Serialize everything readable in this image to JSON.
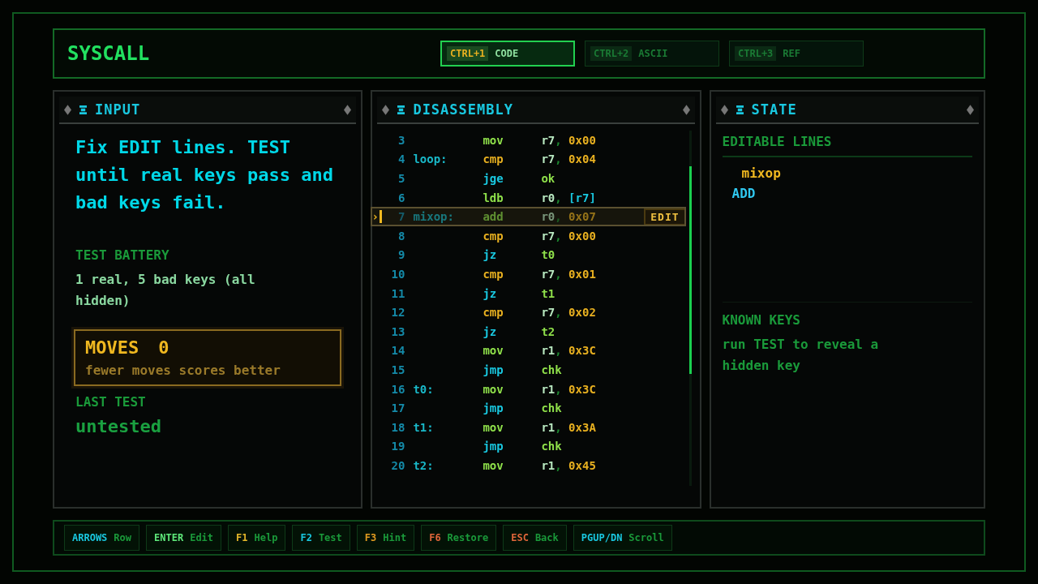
{
  "app_title": "SYSCALL",
  "tabs": [
    {
      "key": "CTRL+1",
      "label": "CODE",
      "selected": true
    },
    {
      "key": "CTRL+2",
      "label": "ASCII",
      "selected": false
    },
    {
      "key": "CTRL+3",
      "label": "REF",
      "selected": false
    }
  ],
  "input_panel": {
    "title": "INPUT",
    "instructions": "Fix EDIT lines. TEST until real keys pass and bad keys fail.",
    "battery_label": "TEST BATTERY",
    "battery_text": "1 real, 5 bad keys (all hidden)",
    "moves": {
      "label": "MOVES",
      "value": "0",
      "hint": "fewer moves scores better"
    },
    "last_test_label": "LAST TEST",
    "last_test_value": "untested"
  },
  "disassembly": {
    "title": "DISASSEMBLY",
    "edit_badge": "EDIT",
    "cursor": "›",
    "lines": [
      {
        "num": "3",
        "op": "mov",
        "kind": "move",
        "args": [
          {
            "text": "r7",
            "kind": "reg"
          },
          {
            "text": ",",
            "kind": "punct"
          },
          {
            "text": " 0x00",
            "kind": "imm"
          }
        ],
        "selected": false
      },
      {
        "num": "4",
        "label": "loop:",
        "op": "cmp",
        "kind": "compare",
        "args": [
          {
            "text": "r7",
            "kind": "reg"
          },
          {
            "text": ",",
            "kind": "punct"
          },
          {
            "text": " 0x04",
            "kind": "imm"
          }
        ],
        "selected": false
      },
      {
        "num": "5",
        "op": "jge",
        "kind": "jump",
        "args": [
          {
            "text": "ok",
            "kind": "target"
          }
        ],
        "selected": false
      },
      {
        "num": "6",
        "op": "ldb",
        "kind": "move",
        "args": [
          {
            "text": "r0",
            "kind": "reg"
          },
          {
            "text": ",",
            "kind": "punct"
          },
          {
            "text": " [r7]",
            "kind": "mem"
          }
        ],
        "selected": false
      },
      {
        "num": "7",
        "label": "mixop:",
        "op": "add",
        "kind": "move",
        "args": [
          {
            "text": "r0",
            "kind": "reg"
          },
          {
            "text": ",",
            "kind": "punct"
          },
          {
            "text": " 0x07",
            "kind": "imm"
          }
        ],
        "selected": true
      },
      {
        "num": "8",
        "op": "cmp",
        "kind": "compare",
        "args": [
          {
            "text": "r7",
            "kind": "reg"
          },
          {
            "text": ",",
            "kind": "punct"
          },
          {
            "text": " 0x00",
            "kind": "imm"
          }
        ],
        "selected": false
      },
      {
        "num": "9",
        "op": "jz",
        "kind": "jump",
        "args": [
          {
            "text": "t0",
            "kind": "target"
          }
        ],
        "selected": false
      },
      {
        "num": "10",
        "op": "cmp",
        "kind": "compare",
        "args": [
          {
            "text": "r7",
            "kind": "reg"
          },
          {
            "text": ",",
            "kind": "punct"
          },
          {
            "text": " 0x01",
            "kind": "imm"
          }
        ],
        "selected": false
      },
      {
        "num": "11",
        "op": "jz",
        "kind": "jump",
        "args": [
          {
            "text": "t1",
            "kind": "target"
          }
        ],
        "selected": false
      },
      {
        "num": "12",
        "op": "cmp",
        "kind": "compare",
        "args": [
          {
            "text": "r7",
            "kind": "reg"
          },
          {
            "text": ",",
            "kind": "punct"
          },
          {
            "text": " 0x02",
            "kind": "imm"
          }
        ],
        "selected": false
      },
      {
        "num": "13",
        "op": "jz",
        "kind": "jump",
        "args": [
          {
            "text": "t2",
            "kind": "target"
          }
        ],
        "selected": false
      },
      {
        "num": "14",
        "op": "mov",
        "kind": "move",
        "args": [
          {
            "text": "r1",
            "kind": "reg"
          },
          {
            "text": ",",
            "kind": "punct"
          },
          {
            "text": " 0x3C",
            "kind": "imm"
          }
        ],
        "selected": false
      },
      {
        "num": "15",
        "op": "jmp",
        "kind": "jump",
        "args": [
          {
            "text": "chk",
            "kind": "target"
          }
        ],
        "selected": false
      },
      {
        "num": "16",
        "label": "t0:",
        "op": "mov",
        "kind": "move",
        "args": [
          {
            "text": "r1",
            "kind": "reg"
          },
          {
            "text": ",",
            "kind": "punct"
          },
          {
            "text": " 0x3C",
            "kind": "imm"
          }
        ],
        "selected": false
      },
      {
        "num": "17",
        "op": "jmp",
        "kind": "jump",
        "args": [
          {
            "text": "chk",
            "kind": "target"
          }
        ],
        "selected": false
      },
      {
        "num": "18",
        "label": "t1:",
        "op": "mov",
        "kind": "move",
        "args": [
          {
            "text": "r1",
            "kind": "reg"
          },
          {
            "text": ",",
            "kind": "punct"
          },
          {
            "text": " 0x3A",
            "kind": "imm"
          }
        ],
        "selected": false
      },
      {
        "num": "19",
        "op": "jmp",
        "kind": "jump",
        "args": [
          {
            "text": "chk",
            "kind": "target"
          }
        ],
        "selected": false
      },
      {
        "num": "20",
        "label": "t2:",
        "op": "mov",
        "kind": "move",
        "args": [
          {
            "text": "r1",
            "kind": "reg"
          },
          {
            "text": ",",
            "kind": "punct"
          },
          {
            "text": " 0x45",
            "kind": "imm"
          }
        ],
        "selected": false
      }
    ]
  },
  "state_panel": {
    "title": "STATE",
    "editable_label": "EDITABLE LINES",
    "editable_lines": [
      {
        "name": "mixop",
        "op": "ADD"
      }
    ],
    "known_keys_label": "KNOWN KEYS",
    "known_keys_text": "run TEST to reveal a hidden key"
  },
  "footer_hints": [
    {
      "key": "ARROWS",
      "action": "Row",
      "color": "#19c8e0"
    },
    {
      "key": "ENTER",
      "action": "Edit",
      "color": "#5ee87a"
    },
    {
      "key": "F1",
      "action": "Help",
      "color": "#e6b82a"
    },
    {
      "key": "F2",
      "action": "Test",
      "color": "#19c8e0"
    },
    {
      "key": "F3",
      "action": "Hint",
      "color": "#e09a20"
    },
    {
      "key": "F6",
      "action": "Restore",
      "color": "#e0663a"
    },
    {
      "key": "ESC",
      "action": "Back",
      "color": "#e0663a"
    },
    {
      "key": "PGUP/DN",
      "action": "Scroll",
      "color": "#19c8e0"
    }
  ]
}
